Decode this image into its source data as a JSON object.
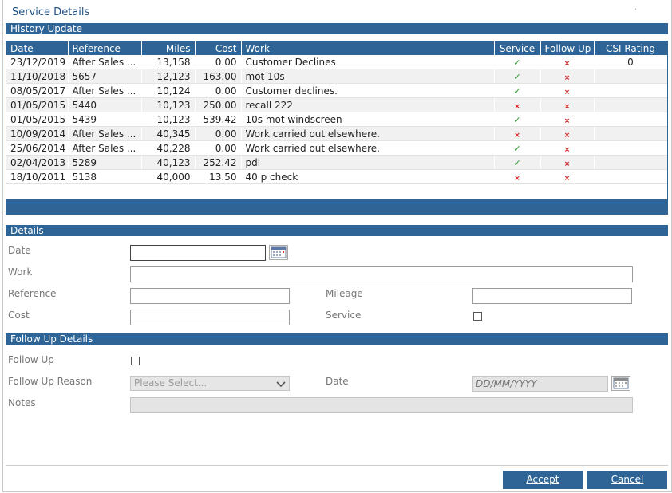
{
  "dialog": {
    "title": "Service Details"
  },
  "history": {
    "header": "History Update",
    "columns": {
      "date": "Date",
      "reference": "Reference",
      "miles": "Miles",
      "cost": "Cost",
      "work": "Work",
      "service": "Service",
      "follow_up": "Follow Up",
      "csi_rating": "CSI Rating"
    },
    "rows": [
      {
        "date": "23/12/2019",
        "reference": "After Sales ...",
        "miles": "13,158",
        "cost": "0.00",
        "work": "Customer Declines",
        "service": "✓",
        "follow_up": "×",
        "csi_rating": "0"
      },
      {
        "date": "11/10/2018",
        "reference": "5657",
        "miles": "12,123",
        "cost": "163.00",
        "work": "mot 10s",
        "service": "✓",
        "follow_up": "×",
        "csi_rating": ""
      },
      {
        "date": "08/05/2017",
        "reference": "After Sales ...",
        "miles": "10,124",
        "cost": "0.00",
        "work": "Customer declines.",
        "service": "✓",
        "follow_up": "×",
        "csi_rating": ""
      },
      {
        "date": "01/05/2015",
        "reference": "5440",
        "miles": "10,123",
        "cost": "250.00",
        "work": "recall 222",
        "service": "×",
        "follow_up": "×",
        "csi_rating": ""
      },
      {
        "date": "01/05/2015",
        "reference": "5439",
        "miles": "10,123",
        "cost": "539.42",
        "work": "10s mot windscreen",
        "service": "✓",
        "follow_up": "×",
        "csi_rating": ""
      },
      {
        "date": "10/09/2014",
        "reference": "After Sales ...",
        "miles": "40,345",
        "cost": "0.00",
        "work": "Work carried out elsewhere.",
        "service": "×",
        "follow_up": "×",
        "csi_rating": ""
      },
      {
        "date": "25/06/2014",
        "reference": "After Sales ...",
        "miles": "40,228",
        "cost": "0.00",
        "work": "Work carried out elsewhere.",
        "service": "✓",
        "follow_up": "×",
        "csi_rating": ""
      },
      {
        "date": "02/04/2013",
        "reference": "5289",
        "miles": "40,123",
        "cost": "252.42",
        "work": "pdi",
        "service": "✓",
        "follow_up": "×",
        "csi_rating": ""
      },
      {
        "date": "18/10/2011",
        "reference": "5138",
        "miles": "40,000",
        "cost": "13.50",
        "work": "40 p check",
        "service": "×",
        "follow_up": "×",
        "csi_rating": ""
      }
    ]
  },
  "details": {
    "header": "Details",
    "date_label": "Date",
    "date_value": "",
    "work_label": "Work",
    "work_value": "",
    "reference_label": "Reference",
    "reference_value": "",
    "mileage_label": "Mileage",
    "mileage_value": "",
    "cost_label": "Cost",
    "cost_value": "",
    "service_label": "Service",
    "service_checked": false
  },
  "follow_up": {
    "header": "Follow Up Details",
    "follow_up_label": "Follow Up",
    "follow_up_checked": false,
    "reason_label": "Follow Up Reason",
    "reason_selected": "Please Select...",
    "date_label": "Date",
    "date_placeholder": "DD/MM/YYYY",
    "notes_label": "Notes",
    "notes_value": ""
  },
  "buttons": {
    "accept": "Accept",
    "cancel": "Cancel"
  },
  "colors": {
    "accent": "#2e6496",
    "tick": "#2a9a2a",
    "cross": "#d62020"
  }
}
